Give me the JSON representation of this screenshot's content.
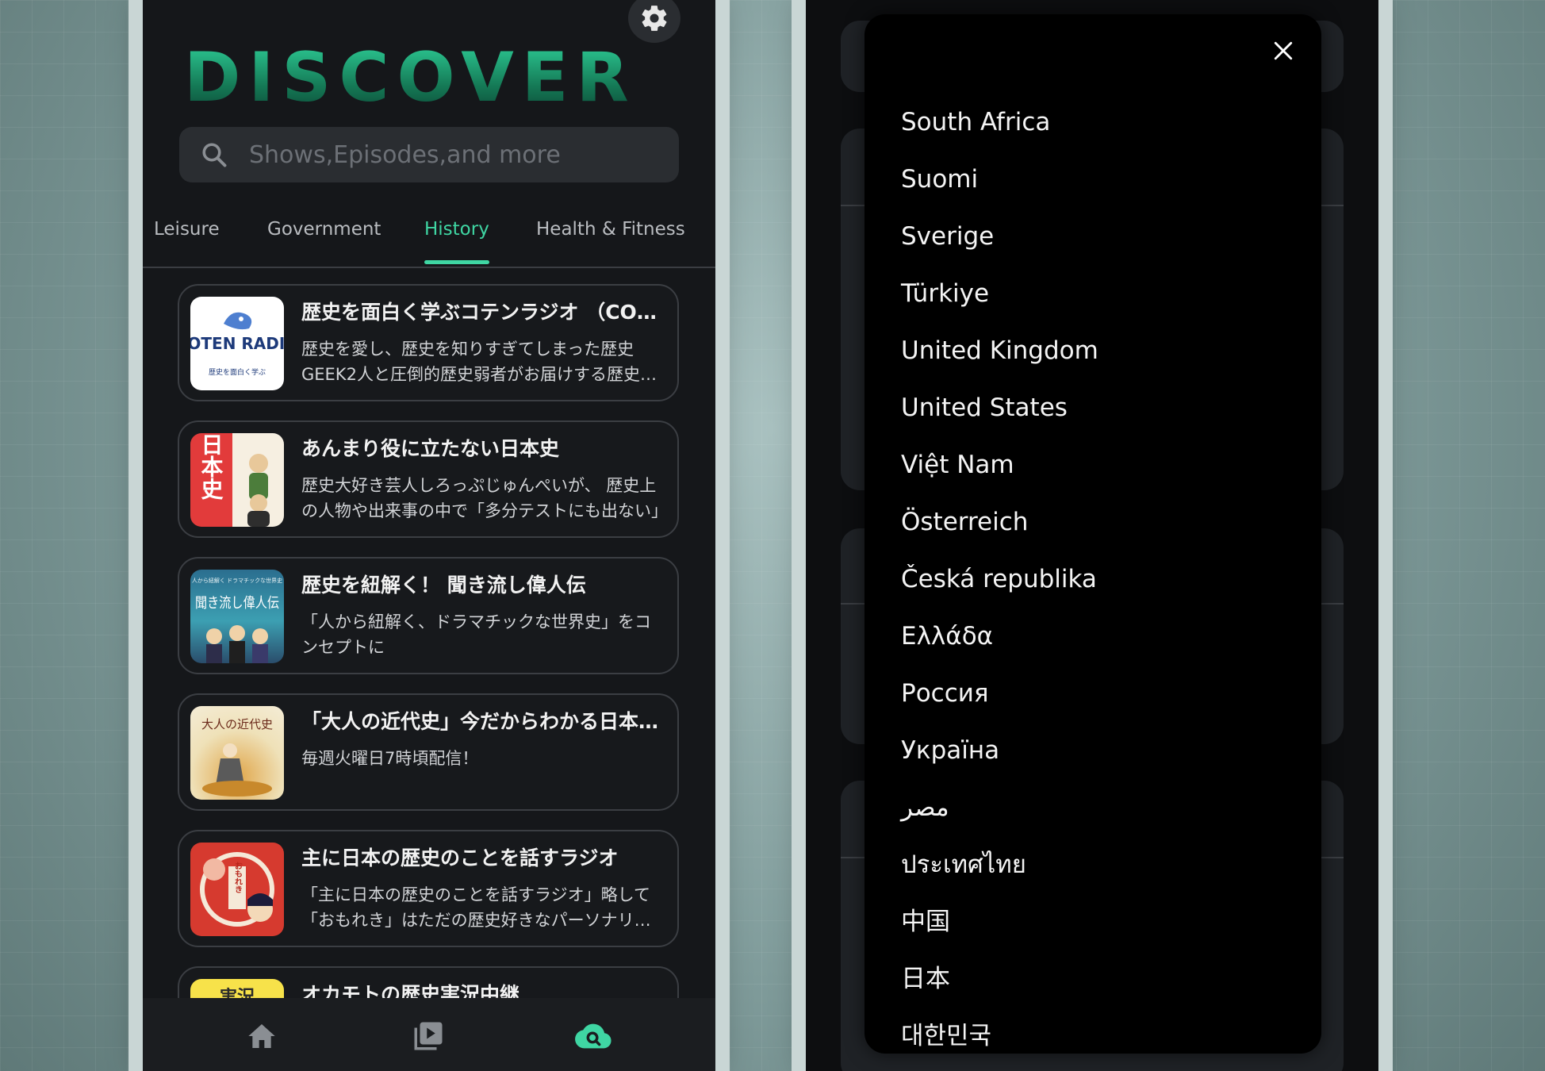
{
  "discover": {
    "title": "DISCOVER",
    "search_placeholder": "Shows,Episodes,and more",
    "tabs": [
      "Leisure",
      "Government",
      "History",
      "Health & Fitness"
    ],
    "active_tab": "History",
    "podcasts": [
      {
        "title": "歴史を面白く学ぶコテンラジオ （COTEN RADIO）",
        "description": "歴史を愛し、歴史を知りすぎてしまった歴史GEEK2人と圧倒的歴史弱者がお届けする歴史エンターテイメント。",
        "thumb_text": "COTEN RADIO",
        "thumb_subtext": "歴史を面白く学ぶ"
      },
      {
        "title": "あんまり役に立たない日本史",
        "description": "歴史大好き芸人しろっぷじゅんぺいが、 歴史上の人物や出来事の中で「多分テストにも出ない」",
        "thumb_text": "日本史"
      },
      {
        "title": "歴史を紐解く！ 聞き流し偉人伝",
        "description": "「人から紐解く、ドラマチックな世界史」をコンセプトに",
        "thumb_text": "聞き流し偉人伝",
        "thumb_subtext": "人から紐解く ドラマチックな世界史"
      },
      {
        "title": "「大人の近代史」今だからわかる日本の近代史",
        "description": "毎週火曜日7時頃配信！",
        "thumb_text": "大人の近代史"
      },
      {
        "title": "主に日本の歴史のことを話すラジオ",
        "description": "「主に日本の歴史のことを話すラジオ」略して「おもれき」はただの歴史好きなパーソナリティが",
        "thumb_text": "おもれき"
      },
      {
        "title": "オカモトの歴史実況中継",
        "description": "",
        "thumb_text": "実況"
      }
    ],
    "nav": [
      {
        "icon": "home-icon"
      },
      {
        "icon": "episodes-icon"
      },
      {
        "icon": "discover-cloud-icon"
      }
    ]
  },
  "country_modal": {
    "countries": [
      "South Africa",
      "Suomi",
      "Sverige",
      "Türkiye",
      "United Kingdom",
      "United States",
      "Việt Nam",
      "Österreich",
      "Česká republika",
      "Ελλάδα",
      "Россия",
      "Україна",
      "مصر",
      "ประเทศไทย",
      "中国",
      "日本",
      "대한민국"
    ]
  },
  "colors": {
    "accent": "#3fd6a3",
    "background": "#15171a",
    "card": "#17191c",
    "modal": "#000000"
  }
}
